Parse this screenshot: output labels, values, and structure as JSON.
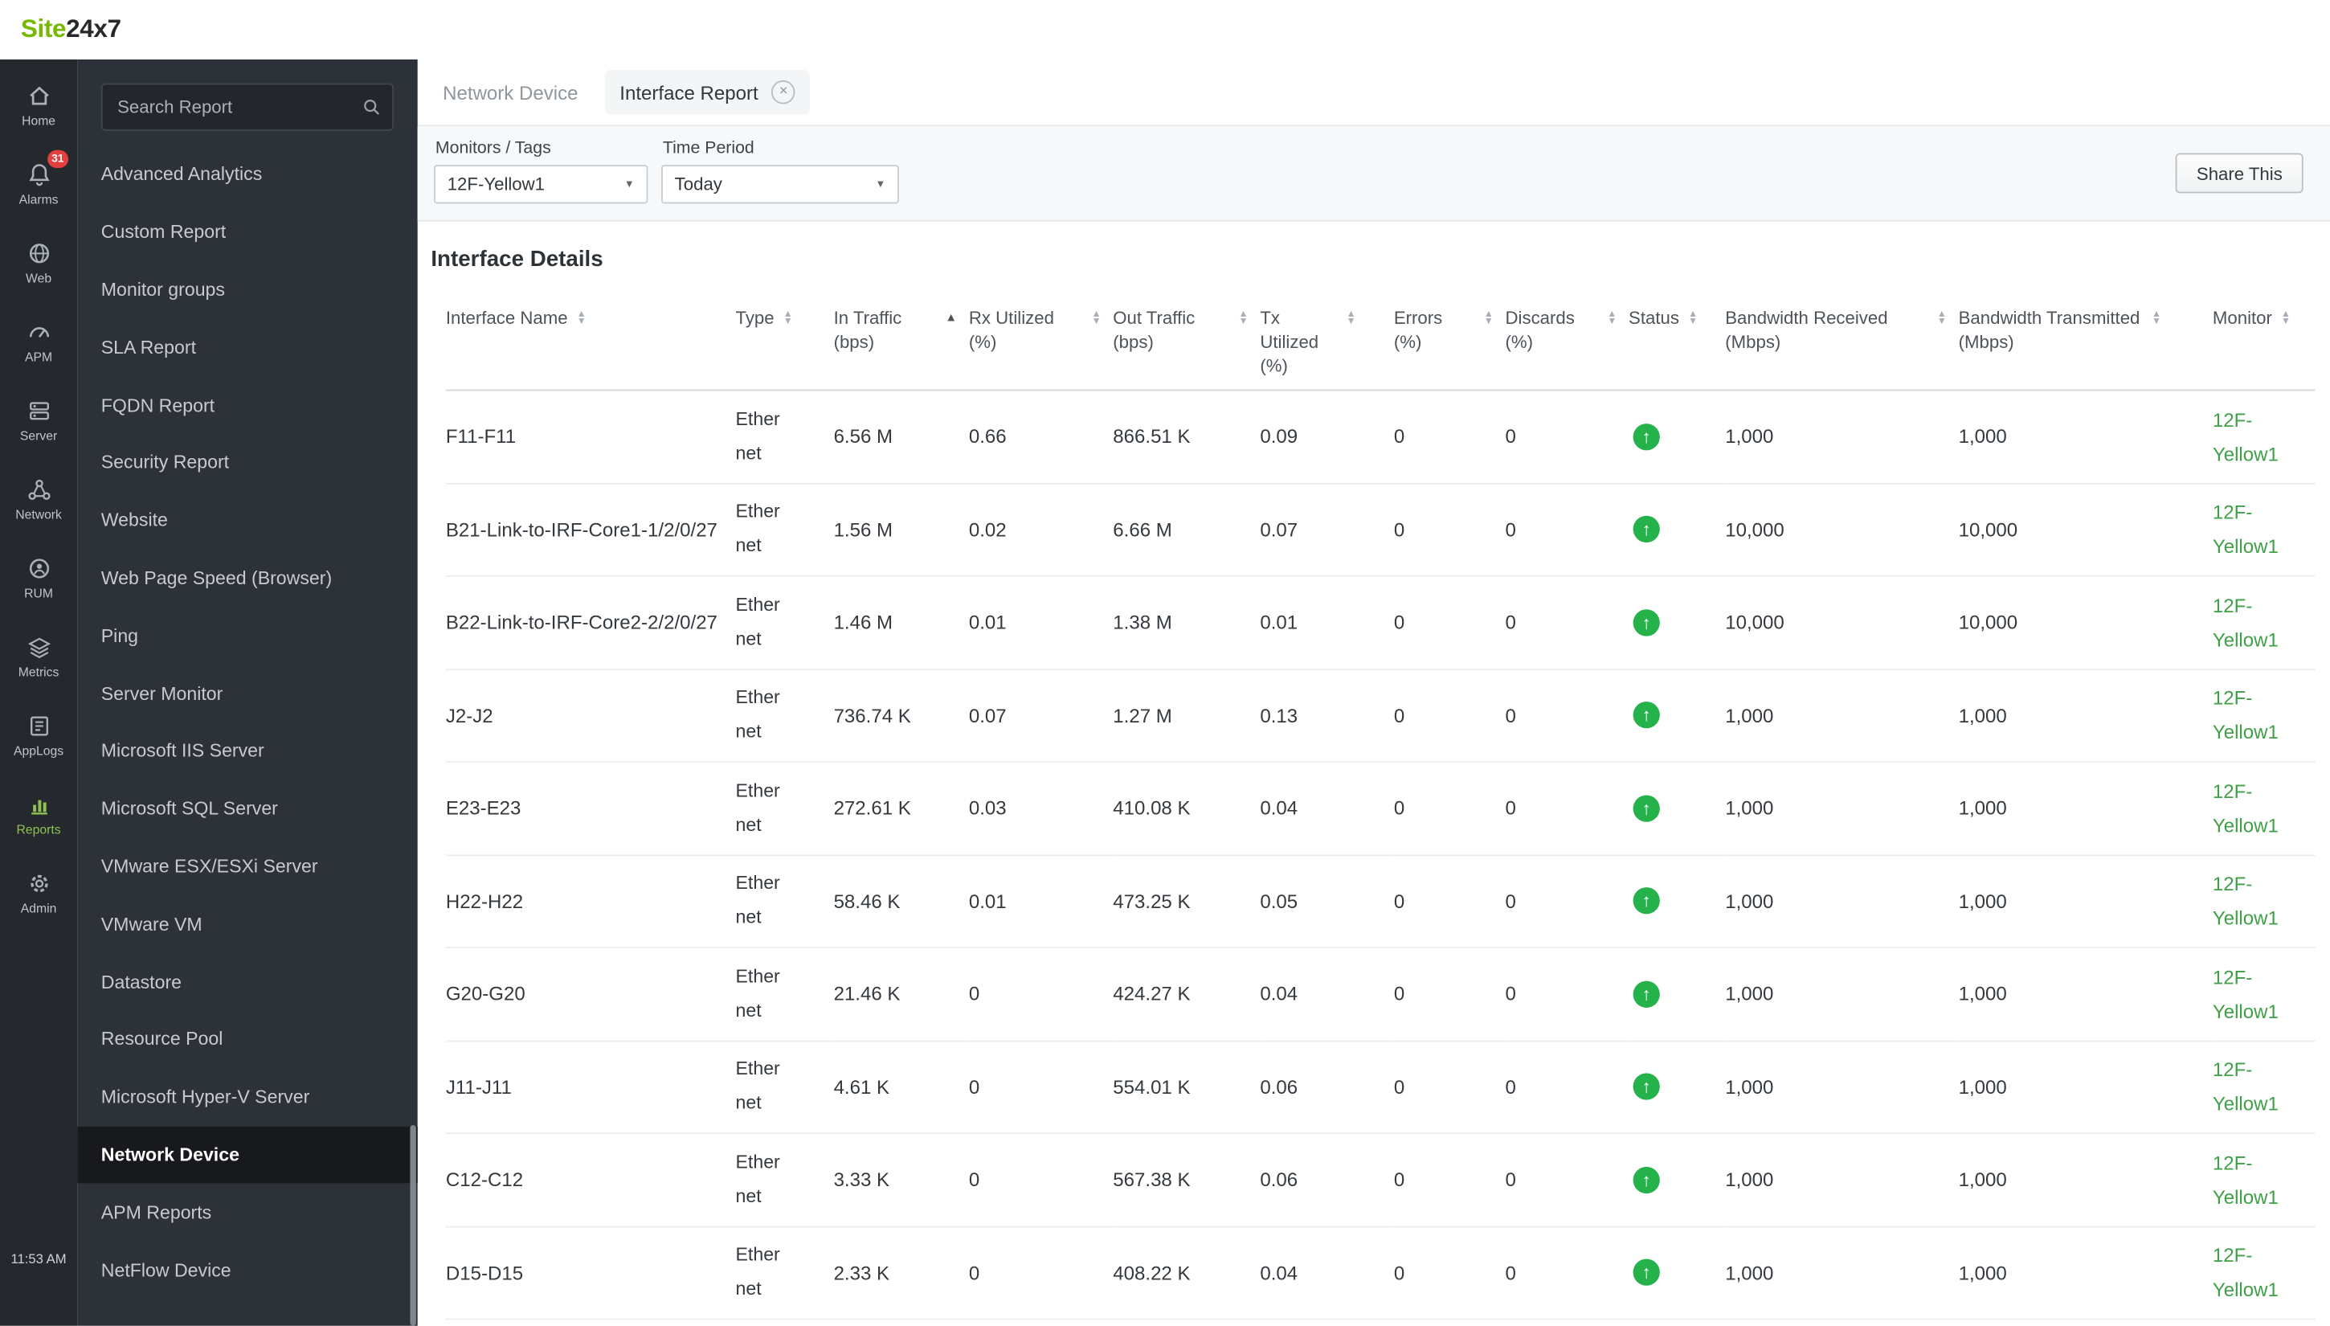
{
  "brand": {
    "logo_green": "Site",
    "logo_dark": "24x7"
  },
  "colors": {
    "logo_green": "#76b900",
    "link_green": "#3fa047",
    "status_green": "#25b24a",
    "badge_red": "#e43f3f",
    "active_nav_green": "#8dc153"
  },
  "rail": {
    "items": [
      {
        "icon": "home-icon",
        "label": "Home"
      },
      {
        "icon": "bell-icon",
        "label": "Alarms",
        "badge": "31"
      },
      {
        "icon": "web-globe-icon",
        "label": "Web"
      },
      {
        "icon": "apm-gauge-icon",
        "label": "APM"
      },
      {
        "icon": "server-icon",
        "label": "Server"
      },
      {
        "icon": "network-icon",
        "label": "Network"
      },
      {
        "icon": "rum-user-icon",
        "label": "RUM"
      },
      {
        "icon": "metrics-layers-icon",
        "label": "Metrics"
      },
      {
        "icon": "applogs-icon",
        "label": "AppLogs"
      },
      {
        "icon": "reports-chart-icon",
        "label": "Reports",
        "active": true
      },
      {
        "icon": "admin-gear-icon",
        "label": "Admin"
      }
    ],
    "time": "11:53 AM"
  },
  "sidebar": {
    "search_placeholder": "Search Report",
    "items": [
      {
        "label": "Advanced Analytics"
      },
      {
        "label": "Custom Report"
      },
      {
        "label": "Monitor groups"
      },
      {
        "label": "SLA Report"
      },
      {
        "label": "FQDN Report"
      },
      {
        "label": "Security Report"
      },
      {
        "label": "Website"
      },
      {
        "label": "Web Page Speed (Browser)"
      },
      {
        "label": "Ping"
      },
      {
        "label": "Server Monitor"
      },
      {
        "label": "Microsoft IIS Server"
      },
      {
        "label": "Microsoft SQL Server"
      },
      {
        "label": "VMware ESX/ESXi Server"
      },
      {
        "label": "VMware VM"
      },
      {
        "label": "Datastore"
      },
      {
        "label": "Resource Pool"
      },
      {
        "label": "Microsoft Hyper-V Server"
      },
      {
        "label": "Network Device",
        "active": true
      },
      {
        "label": "APM Reports"
      },
      {
        "label": "NetFlow Device"
      }
    ]
  },
  "tabs": [
    {
      "label": "Network Device"
    },
    {
      "label": "Interface Report",
      "closable": true
    }
  ],
  "filters": {
    "monitors_label": "Monitors / Tags",
    "monitors_value": "12F-Yellow1",
    "time_label": "Time Period",
    "time_value": "Today",
    "share_button": "Share This"
  },
  "report": {
    "title": "Interface Details"
  },
  "icons": {
    "close": "×",
    "caret_down": "▼",
    "sort_asc": "▲",
    "sort_desc": "▼",
    "status_up": "↑"
  },
  "table": {
    "columns": [
      "Interface Name",
      "Type",
      "In Traffic (bps)",
      "Rx Utilized (%)",
      "Out Traffic (bps)",
      "Tx Utilized (%)",
      "Errors (%)",
      "Discards (%)",
      "Status",
      "Bandwidth Received (Mbps)",
      "Bandwidth Transmitted (Mbps)",
      "Monitor"
    ],
    "sorted_column": "In Traffic (bps)",
    "rows": [
      {
        "interface_name": "F11-F11",
        "type": "Ethernet",
        "in_traffic": "6.56 M",
        "rx_utilized": "0.66",
        "out_traffic": "866.51 K",
        "tx_utilized": "0.09",
        "errors": "0",
        "discards": "0",
        "status": "up",
        "bandwidth_received": "1,000",
        "bandwidth_transmitted": "1,000",
        "monitor": "12F-Yellow1"
      },
      {
        "interface_name": "B21-Link-to-IRF-Core1-1/2/0/27",
        "type": "Ethernet",
        "in_traffic": "1.56 M",
        "rx_utilized": "0.02",
        "out_traffic": "6.66 M",
        "tx_utilized": "0.07",
        "errors": "0",
        "discards": "0",
        "status": "up",
        "bandwidth_received": "10,000",
        "bandwidth_transmitted": "10,000",
        "monitor": "12F-Yellow1"
      },
      {
        "interface_name": "B22-Link-to-IRF-Core2-2/2/0/27",
        "type": "Ethernet",
        "in_traffic": "1.46 M",
        "rx_utilized": "0.01",
        "out_traffic": "1.38 M",
        "tx_utilized": "0.01",
        "errors": "0",
        "discards": "0",
        "status": "up",
        "bandwidth_received": "10,000",
        "bandwidth_transmitted": "10,000",
        "monitor": "12F-Yellow1"
      },
      {
        "interface_name": "J2-J2",
        "type": "Ethernet",
        "in_traffic": "736.74 K",
        "rx_utilized": "0.07",
        "out_traffic": "1.27 M",
        "tx_utilized": "0.13",
        "errors": "0",
        "discards": "0",
        "status": "up",
        "bandwidth_received": "1,000",
        "bandwidth_transmitted": "1,000",
        "monitor": "12F-Yellow1"
      },
      {
        "interface_name": "E23-E23",
        "type": "Ethernet",
        "in_traffic": "272.61 K",
        "rx_utilized": "0.03",
        "out_traffic": "410.08 K",
        "tx_utilized": "0.04",
        "errors": "0",
        "discards": "0",
        "status": "up",
        "bandwidth_received": "1,000",
        "bandwidth_transmitted": "1,000",
        "monitor": "12F-Yellow1"
      },
      {
        "interface_name": "H22-H22",
        "type": "Ethernet",
        "in_traffic": "58.46 K",
        "rx_utilized": "0.01",
        "out_traffic": "473.25 K",
        "tx_utilized": "0.05",
        "errors": "0",
        "discards": "0",
        "status": "up",
        "bandwidth_received": "1,000",
        "bandwidth_transmitted": "1,000",
        "monitor": "12F-Yellow1"
      },
      {
        "interface_name": "G20-G20",
        "type": "Ethernet",
        "in_traffic": "21.46 K",
        "rx_utilized": "0",
        "out_traffic": "424.27 K",
        "tx_utilized": "0.04",
        "errors": "0",
        "discards": "0",
        "status": "up",
        "bandwidth_received": "1,000",
        "bandwidth_transmitted": "1,000",
        "monitor": "12F-Yellow1"
      },
      {
        "interface_name": "J11-J11",
        "type": "Ethernet",
        "in_traffic": "4.61 K",
        "rx_utilized": "0",
        "out_traffic": "554.01 K",
        "tx_utilized": "0.06",
        "errors": "0",
        "discards": "0",
        "status": "up",
        "bandwidth_received": "1,000",
        "bandwidth_transmitted": "1,000",
        "monitor": "12F-Yellow1"
      },
      {
        "interface_name": "C12-C12",
        "type": "Ethernet",
        "in_traffic": "3.33 K",
        "rx_utilized": "0",
        "out_traffic": "567.38 K",
        "tx_utilized": "0.06",
        "errors": "0",
        "discards": "0",
        "status": "up",
        "bandwidth_received": "1,000",
        "bandwidth_transmitted": "1,000",
        "monitor": "12F-Yellow1"
      },
      {
        "interface_name": "D15-D15",
        "type": "Ethernet",
        "in_traffic": "2.33 K",
        "rx_utilized": "0",
        "out_traffic": "408.22 K",
        "tx_utilized": "0.04",
        "errors": "0",
        "discards": "0",
        "status": "up",
        "bandwidth_received": "1,000",
        "bandwidth_transmitted": "1,000",
        "monitor": "12F-Yellow1"
      }
    ]
  }
}
